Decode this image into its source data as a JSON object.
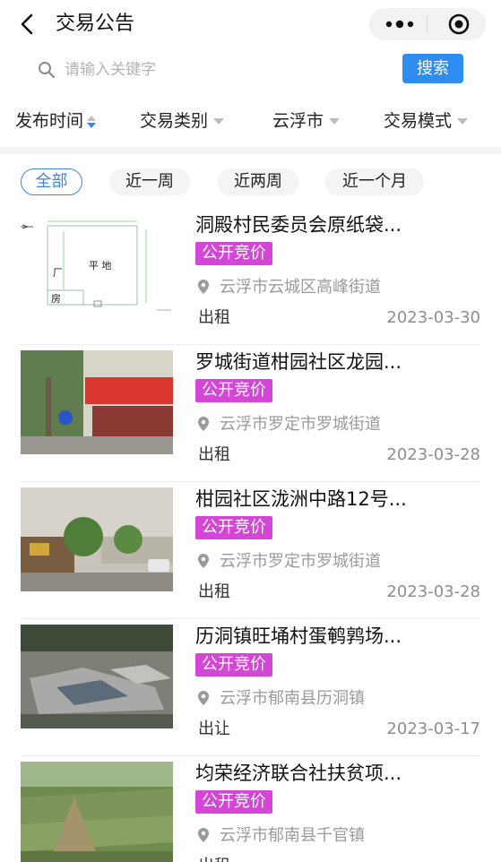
{
  "header": {
    "title": "交易公告",
    "back_icon": "chevron-left-icon",
    "more_icon": "more-dots-icon",
    "close_icon": "target-icon"
  },
  "search": {
    "placeholder": "请输入关键字",
    "value": "",
    "button_label": "搜索"
  },
  "filters": [
    {
      "label": "发布时间",
      "icon": "sort-icon"
    },
    {
      "label": "交易类别",
      "icon": "caret-down-icon"
    },
    {
      "label": "云浮市",
      "icon": "caret-down-icon"
    },
    {
      "label": "交易模式",
      "icon": "caret-down-icon"
    }
  ],
  "tabs": [
    {
      "label": "全部",
      "active": true
    },
    {
      "label": "近一周",
      "active": false
    },
    {
      "label": "近两周",
      "active": false
    },
    {
      "label": "近一个月",
      "active": false
    }
  ],
  "thumb_labels": {
    "plan_flat": "平 地",
    "plan_factory": "厂",
    "plan_room": "房"
  },
  "colors": {
    "accent": "#2f8df2",
    "tag": "#d546d6",
    "active_tab": "#3b87e4"
  },
  "listings": [
    {
      "title": "洞殿村民委员会原纸袋...",
      "tag": "公开竞价",
      "location": "云浮市云城区高峰街道",
      "type": "出租",
      "date": "2023-03-30",
      "thumb": "floor-plan"
    },
    {
      "title": "罗城街道柑园社区龙园...",
      "tag": "公开竞价",
      "location": "云浮市罗定市罗城街道",
      "type": "出租",
      "date": "2023-03-28",
      "thumb": "street-shops-photo"
    },
    {
      "title": "柑园社区泷洲中路12号...",
      "tag": "公开竞价",
      "location": "云浮市罗定市罗城街道",
      "type": "出租",
      "date": "2023-03-28",
      "thumb": "street-building-photo"
    },
    {
      "title": "历洞镇旺埇村蛋鹌鹑场...",
      "tag": "公开竞价",
      "location": "云浮市郁南县历洞镇",
      "type": "出让",
      "date": "2023-03-17",
      "thumb": "debris-photo"
    },
    {
      "title": "均荣经济联合社扶贫项...",
      "tag": "公开竞价",
      "location": "云浮市郁南县千官镇",
      "type": "出租",
      "date": "",
      "thumb": "farmland-photo"
    }
  ]
}
